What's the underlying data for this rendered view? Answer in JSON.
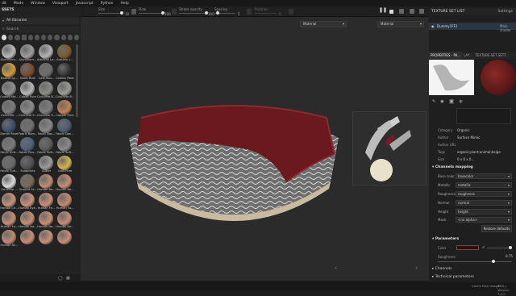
{
  "menu": [
    "dit",
    "Mode",
    "Window",
    "Viewport",
    "Javascript",
    "Python",
    "Help"
  ],
  "toolbar": {
    "size_label": "Size",
    "size_val": "10",
    "flow_label": "Flow",
    "flow_val": "100",
    "opacity_label": "Stroke opacity",
    "opacity_val": "100",
    "spacing_label": "Spacing",
    "spacing_val": "5",
    "rotation_label": "Rotation",
    "rotation_val": "0"
  },
  "assets": {
    "title": "SSETS",
    "library": "All libraries",
    "search": "Search",
    "items": [
      {
        "label": "Aluminum...",
        "color": "#b9b9b9"
      },
      {
        "label": "Aluminum...",
        "color": "#9d9d9d"
      },
      {
        "label": "Artificial La...",
        "color": "#b4b4b4"
      },
      {
        "label": "Autumn L...",
        "color": "#7a5a2a"
      },
      {
        "label": "Baked Lig...",
        "color": "#d19a3a"
      },
      {
        "label": "Basic Rust",
        "color": "#7b4a2e"
      },
      {
        "label": "Cast Iron...",
        "color": "#6d6d6d"
      },
      {
        "label": "Carbon Fiber",
        "color": "#333333"
      },
      {
        "label": "Coated Me...",
        "color": "#8f8f8f"
      },
      {
        "label": "Cobalt Pure",
        "color": "#b7b7b7"
      },
      {
        "label": "Concrete B...",
        "color": "#8b8b86"
      },
      {
        "label": "Concrete B...",
        "color": "#9a9a95"
      },
      {
        "label": "Concrete ...",
        "color": "#7a7a7a"
      },
      {
        "label": "Concrete S...",
        "color": "#8c8c8c"
      },
      {
        "label": "Concrete S...",
        "color": "#7d7d7d"
      },
      {
        "label": "Copper Pure",
        "color": "#c4804e"
      },
      {
        "label": "Denim Rivet",
        "color": "#3b4e6b"
      },
      {
        "label": "Fabric Bam...",
        "color": "#6e6e6e"
      },
      {
        "label": "Fabric Bas...",
        "color": "#878787"
      },
      {
        "label": "Fabric Den...",
        "color": "#4a5a70"
      },
      {
        "label": "Fabric Knit...",
        "color": "#7a7a7a"
      },
      {
        "label": "Fabric Rou...",
        "color": "#4a5f7a"
      },
      {
        "label": "Fabric Soft...",
        "color": "#5a5a5a"
      },
      {
        "label": "Fabric Soft...",
        "color": "#8a8a8a"
      },
      {
        "label": "Fabric Suit...",
        "color": "#6a6a6a"
      },
      {
        "label": "Footprints",
        "color": "#4f4f4f"
      },
      {
        "label": "Glitter",
        "color": "#9a9a9a"
      },
      {
        "label": "Gold Pure",
        "color": "#d8b24a"
      },
      {
        "label": "Gouache ...",
        "color": "#d9d9d9"
      },
      {
        "label": "Ground Gr...",
        "color": "#7a6a55"
      },
      {
        "label": "Human Ba...",
        "color": "#c48a70"
      },
      {
        "label": "Human Be...",
        "color": "#c88b72"
      },
      {
        "label": "Human Ch...",
        "color": "#ca8f75"
      },
      {
        "label": "Human Eye...",
        "color": "#cc9078"
      },
      {
        "label": "Human Fe...",
        "color": "#c98d73"
      },
      {
        "label": "Human Fo...",
        "color": "#c68a71"
      },
      {
        "label": "Human Fo...",
        "color": "#c68a71"
      },
      {
        "label": "Human He...",
        "color": "#c98d73"
      },
      {
        "label": "Human Ne...",
        "color": "#ca8e74"
      },
      {
        "label": "Human Ne...",
        "color": "#c88c72"
      },
      {
        "label": "Human Sk...",
        "color": "#c48a70"
      },
      {
        "label": "",
        "color": "#c88c72"
      },
      {
        "label": "",
        "color": "#ca8f75"
      },
      {
        "label": "",
        "color": "#c98d73"
      }
    ]
  },
  "viewport": {
    "left_mode": "Material",
    "right_mode": "Material"
  },
  "texture_set_list": {
    "title": "TEXTURE SET LIST",
    "settings": "Settings",
    "item": "Dummy1FF2",
    "shader": "Main shader"
  },
  "props_tabs": {
    "properties": "PROPERTIES - PA...",
    "layers": "LAY...",
    "tex_settings": "TEXTURE SET SETT..."
  },
  "info": {
    "category_label": "Category",
    "category_val": "Organic",
    "author_label": "Author",
    "author_val": "Surface Mimic",
    "url_label": "Author URL",
    "url_val": "",
    "tags_label": "Tags",
    "tags_val": "organic;plant;animal;beige",
    "size_label": "Size",
    "size_val": "0 x 0 x 0..."
  },
  "channels": {
    "title": "Channels mapping",
    "rows": [
      {
        "label": "Base color",
        "val": "basecolor"
      },
      {
        "label": "Metallic",
        "val": "metallic"
      },
      {
        "label": "Roughness",
        "val": "roughness"
      },
      {
        "label": "Normal",
        "val": "normal"
      },
      {
        "label": "Height",
        "val": "height"
      }
    ],
    "mask_label": "Mask",
    "mask_val": "<no alpha>",
    "restore": "Restore defaults"
  },
  "parameters": {
    "title": "Parameters",
    "color_label": "Color",
    "color_hex": "#3a0a0a",
    "roughness_label": "Roughness",
    "roughness_val": "0.75",
    "roughness_level": 0.75
  },
  "collapsed": {
    "channels": "Channels",
    "technical": "Technical parameters"
  },
  "status": {
    "cache": "Cache Disk Usage:",
    "cache_val": "38% | Version: 7.2.0"
  }
}
